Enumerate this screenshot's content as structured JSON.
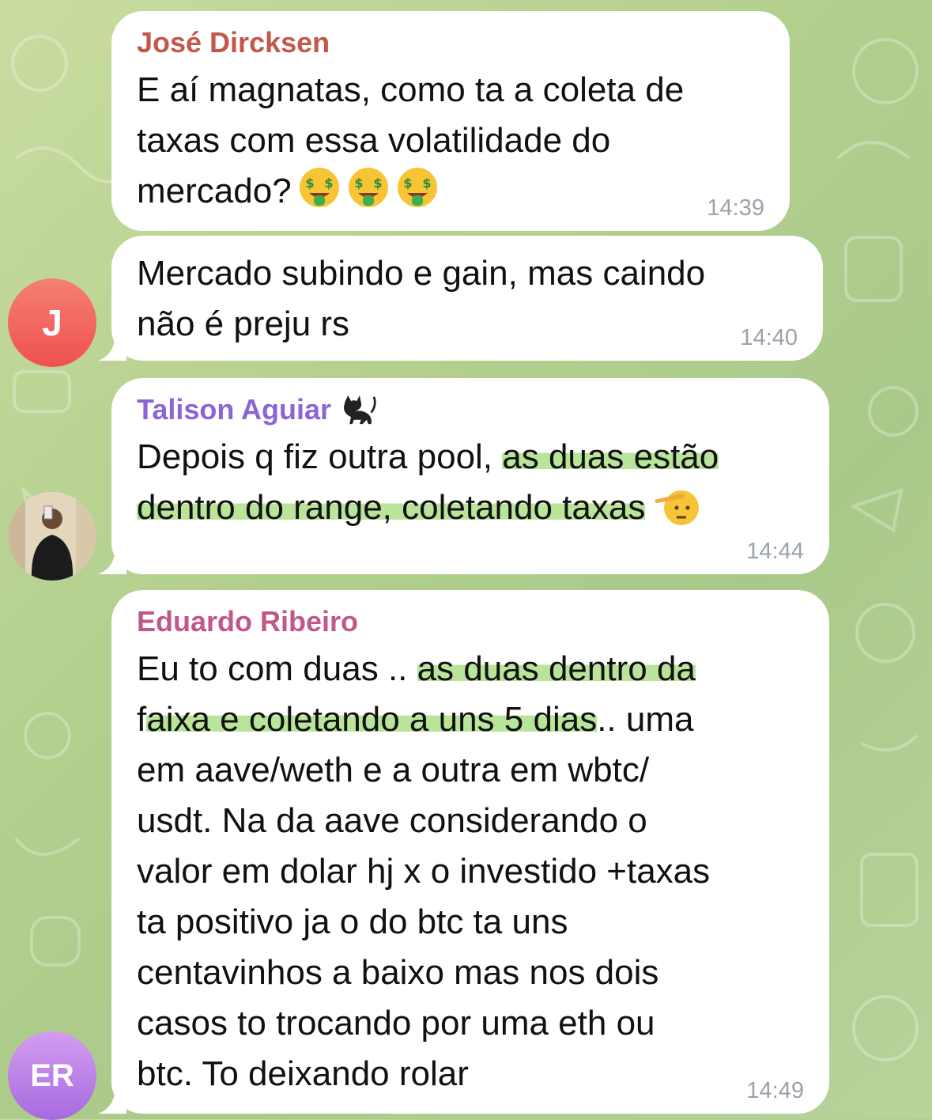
{
  "messages": [
    {
      "sender": "José Dircksen",
      "sender_color": "#c3574a",
      "text_lines": [
        "E aí magnatas, como ta a coleta de",
        "taxas com essa volatilidade do",
        "mercado?"
      ],
      "time": "14:39",
      "emoji": "money-mouth-face"
    },
    {
      "text_lines": [
        "Mercado subindo e gain, mas caindo",
        "não é preju rs"
      ],
      "time": "14:40",
      "avatar_initials": "J",
      "avatar_color": "#ef6161"
    },
    {
      "sender": "Talison Aguiar",
      "sender_color": "#8b64d6",
      "sender_emoji": "black-cat",
      "line1_plain": "Depois q fiz outra pool, ",
      "line1_highlight": "as duas estão",
      "line2_highlight": "dentro do range, coletando taxas",
      "time": "14:44",
      "end_emoji": "saluting-face"
    },
    {
      "sender": "Eduardo Ribeiro",
      "sender_color": "#c0568a",
      "line1_plain": "Eu to com duas .. ",
      "line1_highlight": "as duas dentro da",
      "line2_start": "f",
      "line2_highlight": "aixa e coletando a uns 5 dias",
      "line2_end": ".. uma",
      "rest_lines": [
        "em aave/weth e a outra em wbtc/",
        "usdt. Na da aave considerando o",
        "valor em dolar hj x o investido +taxas",
        "ta positivo ja o do btc ta uns",
        "centavinhos a baixo mas nos dois",
        "casos to trocando por uma eth ou",
        "btc. To deixando rolar"
      ],
      "time": "14:49",
      "avatar_initials": "ER",
      "avatar_color": "#b77ce6"
    }
  ]
}
